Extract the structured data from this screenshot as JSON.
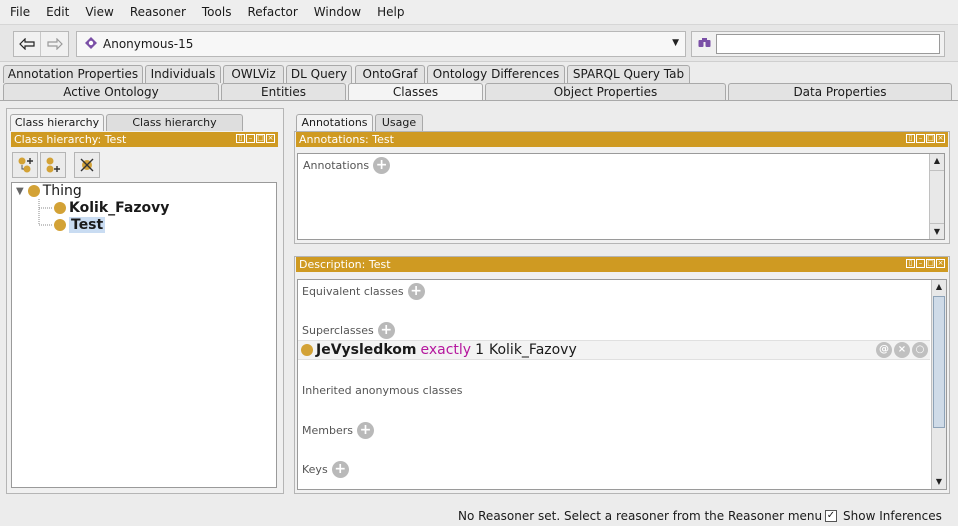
{
  "menu": [
    "File",
    "Edit",
    "View",
    "Reasoner",
    "Tools",
    "Refactor",
    "Window",
    "Help"
  ],
  "toolbar": {
    "back_icon": "arrow-left-icon",
    "forward_icon": "arrow-right-icon",
    "ontology_value": "Anonymous-15",
    "search_value": ""
  },
  "tabs_row1": [
    "Annotation Properties",
    "Individuals",
    "OWLViz",
    "DL Query",
    "OntoGraf",
    "Ontology Differences",
    "SPARQL Query Tab"
  ],
  "tabs_row2": [
    "Active Ontology",
    "Entities",
    "Classes",
    "Object Properties",
    "Data Properties"
  ],
  "active_tab": "Classes",
  "left": {
    "subtabs": [
      "Class hierarchy",
      "Class hierarchy (inferred)"
    ],
    "header": "Class hierarchy: Test",
    "tree": {
      "root": "Thing",
      "children": [
        "Kolik_Fazovy",
        "Test"
      ],
      "selected": "Test"
    }
  },
  "right": {
    "subtabs": [
      "Annotations",
      "Usage"
    ],
    "annotations_header": "Annotations: Test",
    "annotations_label": "Annotations",
    "description_header": "Description: Test",
    "sections": {
      "equivalent": "Equivalent classes",
      "superclasses": "Superclasses",
      "inherited": "Inherited anonymous classes",
      "members": "Members",
      "keys": "Keys"
    },
    "axiom": {
      "property": "JeVysledkom",
      "keyword": "exactly",
      "cardinality": "1",
      "filler": "Kolik_Fazovy"
    }
  },
  "status": {
    "message": "No Reasoner set. Select a reasoner from the Reasoner menu",
    "show_inferences": "Show Inferences",
    "show_inferences_checked": true
  },
  "colors": {
    "view_header": "#cf9a22",
    "class_dot": "#d3a236",
    "keyword": "#b5179e"
  }
}
